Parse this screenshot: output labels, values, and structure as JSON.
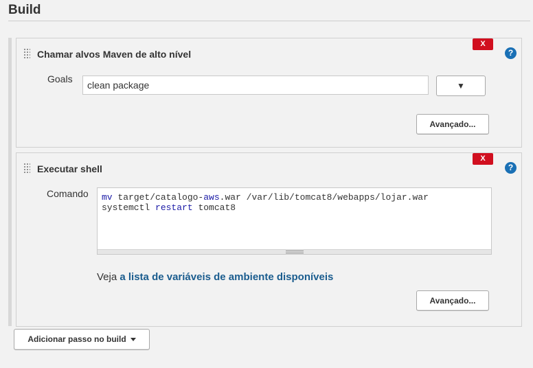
{
  "section": {
    "title": "Build"
  },
  "steps": [
    {
      "title": "Chamar alvos Maven de alto nível",
      "delete_label": "X",
      "help_label": "?",
      "goals": {
        "label": "Goals",
        "value": "clean package",
        "expand_label": "▼"
      },
      "advanced_label": "Avançado..."
    },
    {
      "title": "Executar shell",
      "delete_label": "X",
      "help_label": "?",
      "command": {
        "label": "Comando",
        "line1": {
          "cmd": "mv",
          "rest_a": " target/catalogo-",
          "highlight": "aws",
          "rest_b": ".war /var/lib/tomcat8/webapps/lojar.war"
        },
        "line2": {
          "cmd": "systemctl",
          "space": " ",
          "highlight": "restart",
          "rest": " tomcat8"
        }
      },
      "env_note": {
        "prefix": "Veja ",
        "link": "a lista de variáveis de ambiente disponíveis"
      },
      "advanced_label": "Avançado..."
    }
  ],
  "add_step": {
    "label": "Adicionar passo no build"
  },
  "colors": {
    "delete": "#d10f1f",
    "help": "#1a70b5",
    "link": "#1a5c8e",
    "keyword": "#1a1aa6"
  },
  "icons": {
    "drag": "drag-handle-icon",
    "help": "help-icon",
    "expand": "chevron-down-icon",
    "dropdown": "caret-down-icon"
  }
}
